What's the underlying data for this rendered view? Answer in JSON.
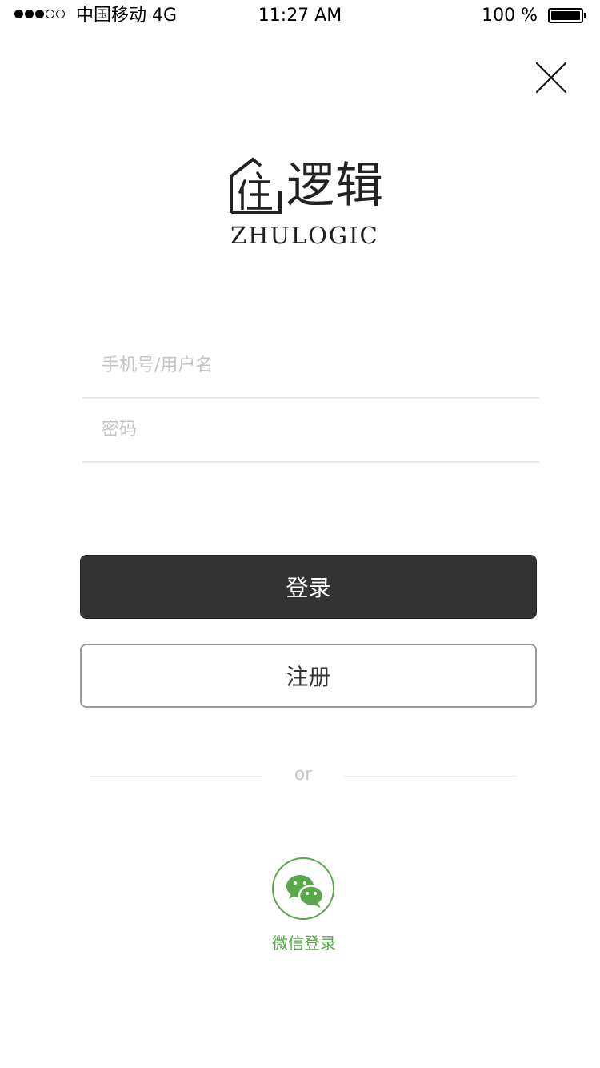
{
  "status_bar": {
    "carrier": "中国移动 4G",
    "time": "11:27 AM",
    "battery_text": "100 %",
    "signal_bars_filled": 3,
    "signal_bars_total": 5
  },
  "close": {
    "icon": "close-icon"
  },
  "logo": {
    "icon": "house-logo-icon",
    "chinese_text": "逻辑",
    "english_text": "ZHULOGIC"
  },
  "form": {
    "username_placeholder": "手机号/用户名",
    "username_value": "",
    "password_placeholder": "密码",
    "password_value": ""
  },
  "buttons": {
    "login_label": "登录",
    "register_label": "注册"
  },
  "divider": {
    "text": "or"
  },
  "wechat": {
    "icon": "wechat-icon",
    "label": "微信登录",
    "color": "#5aa64b"
  },
  "colors": {
    "primary_button": "#333333",
    "placeholder": "#c4c4c4",
    "accent": "#5aa64b"
  }
}
